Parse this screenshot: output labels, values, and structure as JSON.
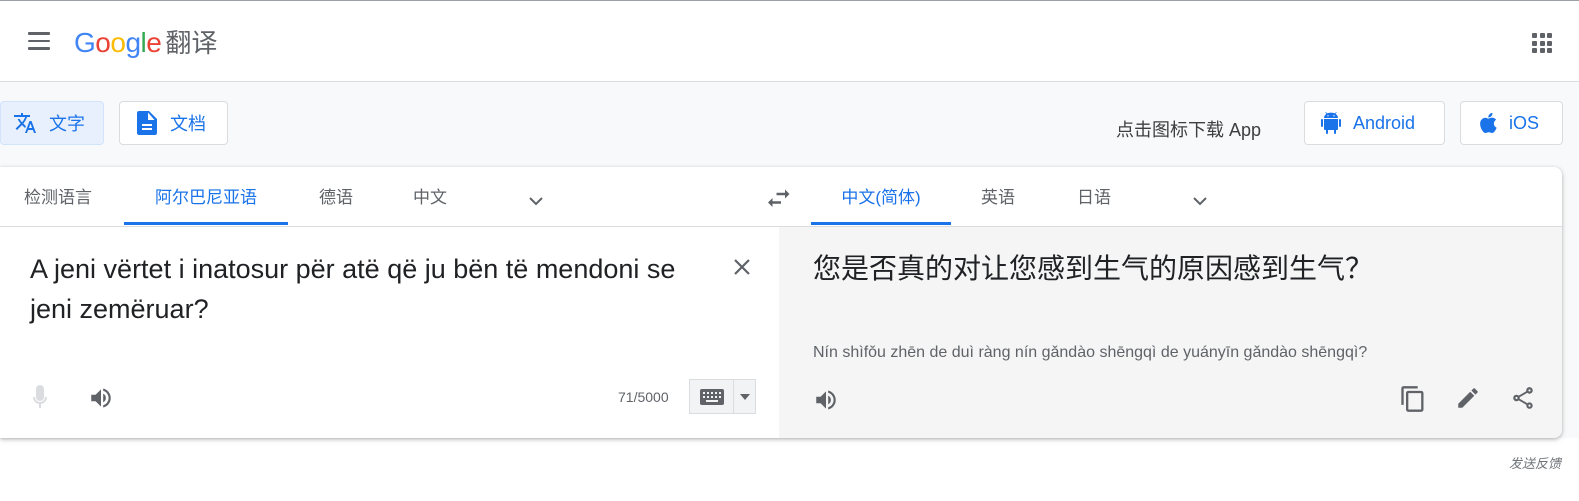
{
  "header": {
    "logo_text": "Google",
    "product_name": "翻译",
    "menu_icon": "hamburger-menu-icon",
    "apps_icon": "apps-grid-icon"
  },
  "toolbar": {
    "text_mode_label": "文字",
    "doc_mode_label": "文档",
    "download_text": "点击图标下载 App",
    "android_label": "Android",
    "ios_label": "iOS",
    "active_mode": "文字"
  },
  "source_langs": {
    "tabs": [
      "检测语言",
      "阿尔巴尼亚语",
      "德语",
      "中文"
    ],
    "active": "阿尔巴尼亚语"
  },
  "target_langs": {
    "tabs": [
      "中文(简体)",
      "英语",
      "日语"
    ],
    "active": "中文(简体)"
  },
  "source": {
    "text": "A jeni vërtet i inatosur për atë që ju bën të mendoni se jeni zemëruar?",
    "char_count": "71/5000"
  },
  "target": {
    "text": "您是否真的对让您感到生气的原因感到生气？",
    "romanization": "Nín shìfǒu zhēn de duì ràng nín gǎndào shēngqì de yuányīn gǎndào shēngqì?"
  },
  "footer": {
    "feedback_label": "发送反馈"
  },
  "colors": {
    "accent": "#1a73e8",
    "active_bg": "#e8f0fe",
    "panel_bg": "#f5f5f5"
  }
}
